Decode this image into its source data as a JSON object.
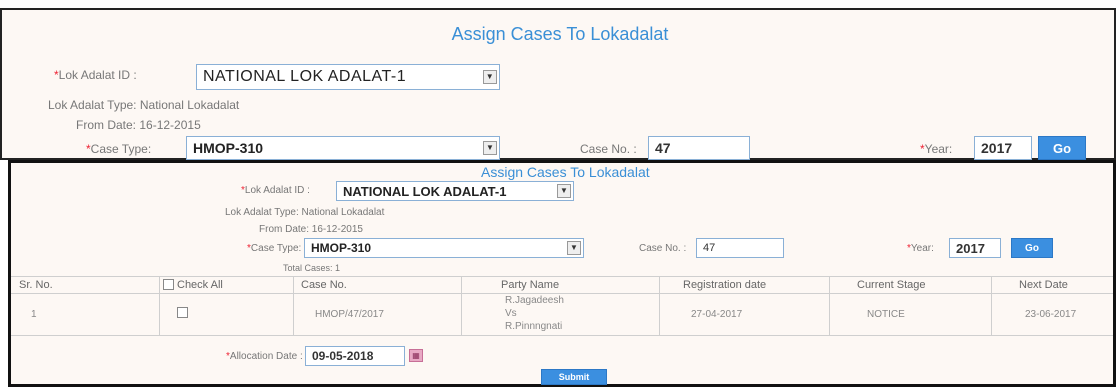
{
  "top_form": {
    "title": "Assign Cases To Lokadalat",
    "lok_adalat_id_label": "Lok Adalat ID :",
    "lok_adalat_id_value": "NATIONAL LOK ADALAT-1",
    "lok_adalat_type_label": "Lok Adalat Type:",
    "lok_adalat_type_value": "National Lokadalat",
    "from_date_label": "From Date:",
    "from_date_value": "16-12-2015",
    "case_type_label": "Case Type:",
    "case_type_value": "HMOP-310",
    "case_no_label": "Case No. :",
    "case_no_value": "47",
    "year_label": "Year:",
    "year_value": "2017",
    "go_label": "Go",
    "required_mark": "*"
  },
  "bottom_form": {
    "title": "Assign Cases To Lokadalat",
    "lok_adalat_id_label": "Lok Adalat ID :",
    "lok_adalat_id_value": "NATIONAL LOK ADALAT-1",
    "lok_adalat_type_label": "Lok Adalat Type:",
    "lok_adalat_type_value": "National Lokadalat",
    "from_date_label": "From Date:",
    "from_date_value": "16-12-2015",
    "case_type_label": "Case Type:",
    "case_type_value": "HMOP-310",
    "case_no_label": "Case No. :",
    "case_no_value": "47",
    "year_label": "Year:",
    "year_value": "2017",
    "go_label": "Go",
    "total_cases_label": "Total Cases: 1",
    "required_mark": "*",
    "table": {
      "headers": [
        "Sr. No.",
        "Check All",
        "Case No.",
        "Party Name",
        "Registration date",
        "Current Stage",
        "Next Date"
      ],
      "rows": [
        {
          "sr_no": "1",
          "case_no": "HMOP/47/2017",
          "party_line1": "R.Jagadeesh",
          "party_line2": "Vs",
          "party_line3": "R.Pinnngnati",
          "registration_date": "27-04-2017",
          "current_stage": "NOTICE",
          "next_date": "23-06-2017"
        }
      ]
    },
    "allocation_date_label": "Allocation Date :",
    "allocation_date_value": "09-05-2018",
    "submit_label": "Submit"
  },
  "colors": {
    "accent": "#3b8fe0",
    "title": "#3a8fd6",
    "required": "#e23",
    "panel_bg": "#fdf8f4"
  }
}
